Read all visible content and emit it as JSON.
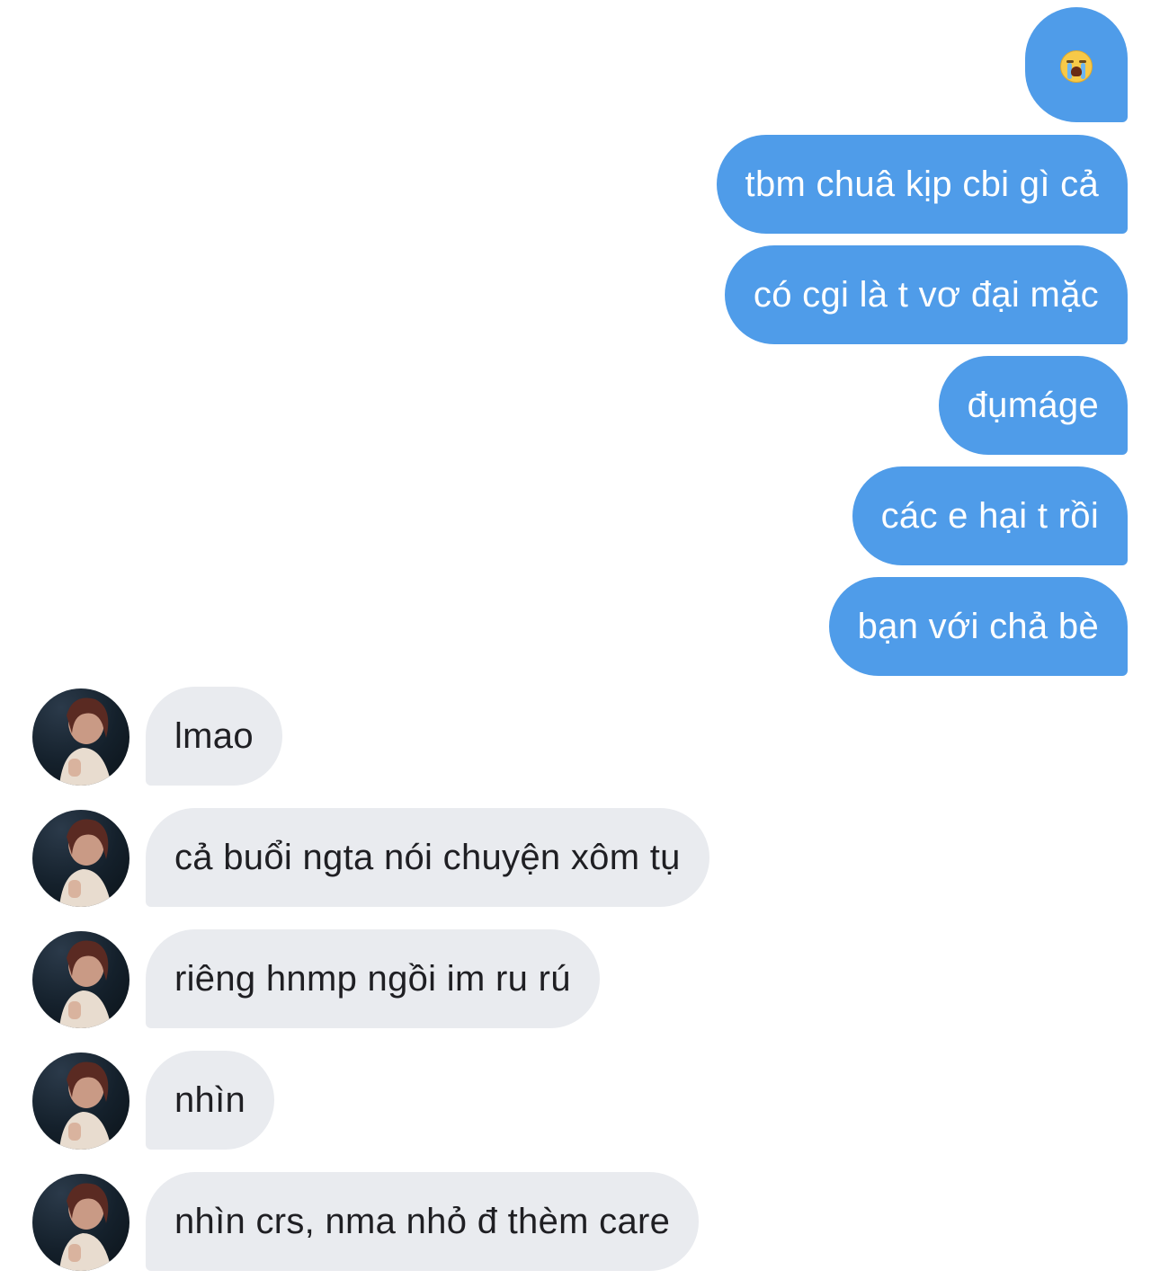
{
  "messages": {
    "outgoing": [
      {
        "text": "😭",
        "icon": "loudly-crying-face-emoji"
      },
      {
        "text": "tbm chuâ kịp cbi gì cả"
      },
      {
        "text": "có cgi là t vơ đại mặc"
      },
      {
        "text": "đụmáge"
      },
      {
        "text": "các e hại t rồi"
      },
      {
        "text": "bạn với chả bè"
      }
    ],
    "incoming": [
      {
        "text": "lmao"
      },
      {
        "text": "cả buổi ngta nói chuyện xôm tụ"
      },
      {
        "text": "riêng hnmp ngồi im ru rú"
      },
      {
        "text": "nhìn"
      },
      {
        "text": "nhìn crs, nma nhỏ đ thèm care"
      }
    ]
  },
  "colors": {
    "outgoing_bubble": "#4f9ce9",
    "incoming_bubble": "#e9ebef",
    "background": "#ffffff"
  }
}
